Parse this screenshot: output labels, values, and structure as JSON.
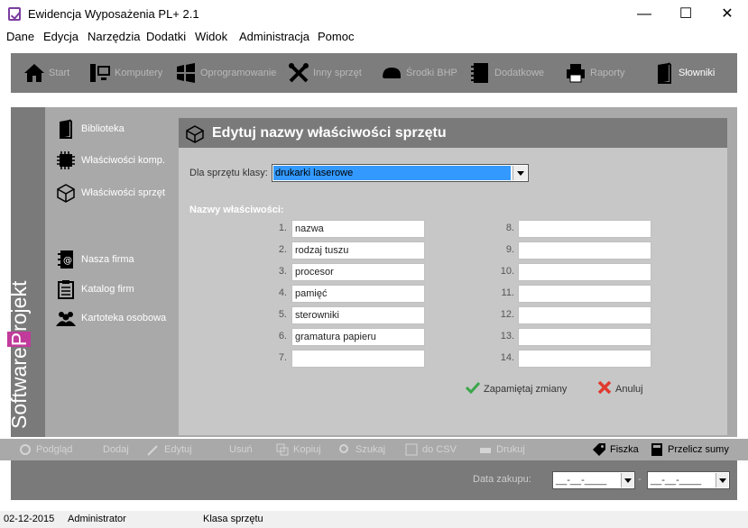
{
  "window": {
    "title": "Ewidencja Wyposażenia PL+ 2.1",
    "minimize": "—",
    "maximize": "☐",
    "close": "✕"
  },
  "menu": [
    "Dane",
    "Edycja",
    "Narzędzia",
    "Dodatki",
    "Widok",
    "Administracja",
    "Pomoc"
  ],
  "toolbar": [
    {
      "label": "Start",
      "icon": "home-icon"
    },
    {
      "label": "Komputery",
      "icon": "computer-icon"
    },
    {
      "label": "Oprogramowanie",
      "icon": "windows-icon"
    },
    {
      "label": "Inny sprzęt",
      "icon": "tools-icon"
    },
    {
      "label": "Środki BHP",
      "icon": "helmet-icon"
    },
    {
      "label": "Dodatkowe",
      "icon": "notebook-icon"
    },
    {
      "label": "Raporty",
      "icon": "printer-icon"
    },
    {
      "label": "Słowniki",
      "icon": "book-icon",
      "active": true
    }
  ],
  "brand": {
    "part1": "Software",
    "part2": "P",
    "part3": "rojekt"
  },
  "nav": [
    {
      "label": "Biblioteka",
      "icon": "book-icon"
    },
    {
      "label": "Właściwości komp.",
      "icon": "chip-icon"
    },
    {
      "label": "Właściwości sprzęt",
      "icon": "cube-icon",
      "active": true
    },
    {
      "label": "Nasza firma",
      "icon": "address-book-icon"
    },
    {
      "label": "Katalog firm",
      "icon": "clipboard-icon"
    },
    {
      "label": "Kartoteka osobowa",
      "icon": "people-icon"
    }
  ],
  "editor": {
    "title": "Edytuj nazwy właściwości sprzętu",
    "class_label": "Dla sprzętu klasy:",
    "class_value": "drukarki laserowe",
    "names_label": "Nazwy właściwości:",
    "left": [
      {
        "num": "1.",
        "value": "nazwa"
      },
      {
        "num": "2.",
        "value": "rodzaj tuszu"
      },
      {
        "num": "3.",
        "value": "procesor"
      },
      {
        "num": "4.",
        "value": "pamięć"
      },
      {
        "num": "5.",
        "value": "sterowniki"
      },
      {
        "num": "6.",
        "value": "gramatura papieru"
      },
      {
        "num": "7.",
        "value": ""
      }
    ],
    "right": [
      {
        "num": "8.",
        "value": ""
      },
      {
        "num": "9.",
        "value": ""
      },
      {
        "num": "10.",
        "value": ""
      },
      {
        "num": "11.",
        "value": ""
      },
      {
        "num": "12.",
        "value": ""
      },
      {
        "num": "13.",
        "value": ""
      },
      {
        "num": "14.",
        "value": ""
      }
    ],
    "save_label": "Zapamiętaj zmiany",
    "cancel_label": "Anuluj"
  },
  "actions": [
    {
      "label": "Podgląd",
      "enabled": false
    },
    {
      "label": "Dodaj",
      "enabled": false
    },
    {
      "label": "Edytuj",
      "enabled": false
    },
    {
      "label": "Usuń",
      "enabled": false
    },
    {
      "label": "Kopiuj",
      "enabled": false
    },
    {
      "label": "Szukaj",
      "enabled": false
    },
    {
      "label": "do CSV",
      "enabled": false
    },
    {
      "label": "Drukuj",
      "enabled": false
    },
    {
      "label": "Fiszka",
      "enabled": true
    },
    {
      "label": "Przelicz sumy",
      "enabled": true
    }
  ],
  "datebar": {
    "label": "Data zakupu:",
    "from": "__-__-____",
    "sep": "-",
    "to": "__-__-____"
  },
  "status": {
    "date": "02-12-2015",
    "user": "Administrator",
    "context": "Klasa sprzętu"
  },
  "colors": {
    "accent": "#c13b9b",
    "panel_dark": "#7a7a7a",
    "panel_mid": "#a9a9a9",
    "panel_light": "#c7c7c7",
    "selection": "#3399ff"
  }
}
